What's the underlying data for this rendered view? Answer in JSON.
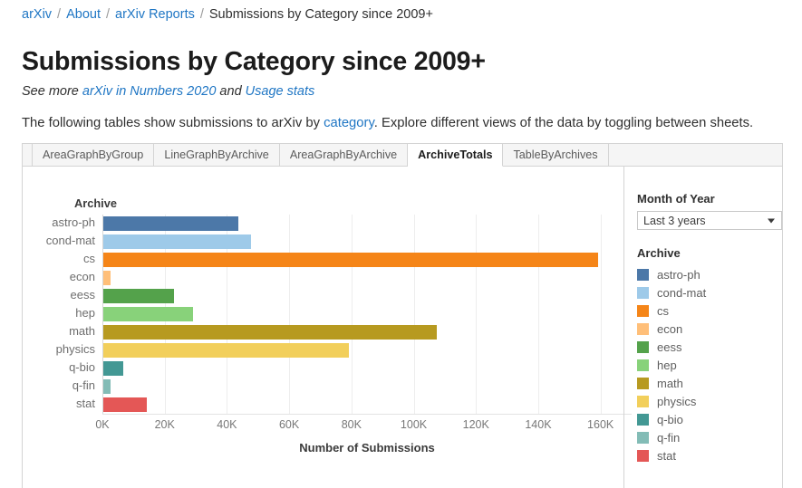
{
  "breadcrumb": {
    "items": [
      {
        "label": "arXiv",
        "link": true
      },
      {
        "label": "About",
        "link": true
      },
      {
        "label": "arXiv Reports",
        "link": true
      },
      {
        "label": "Submissions by Category since 2009+",
        "link": false
      }
    ],
    "separator": "/"
  },
  "page_title": "Submissions by Category since 2009+",
  "seemore": {
    "prefix": "See more ",
    "link1": "arXiv in Numbers 2020",
    "middle": " and ",
    "link2": "Usage stats"
  },
  "intro": {
    "part1": "The following tables show submissions to arXiv by ",
    "link": "category",
    "part2": ". Explore different views of the data by toggling between sheets."
  },
  "tabs": [
    {
      "label": "AreaGraphByGroup",
      "active": false
    },
    {
      "label": "LineGraphByArchive",
      "active": false
    },
    {
      "label": "AreaGraphByArchive",
      "active": false
    },
    {
      "label": "ArchiveTotals",
      "active": true
    },
    {
      "label": "TableByArchives",
      "active": false
    }
  ],
  "filter": {
    "label": "Month of Year",
    "value": "Last 3 years",
    "caret": "chevron-down-icon"
  },
  "legend": {
    "title": "Archive",
    "items": [
      {
        "label": "astro-ph",
        "color": "#4c78a8"
      },
      {
        "label": "cond-mat",
        "color": "#9ecae9"
      },
      {
        "label": "cs",
        "color": "#f58518"
      },
      {
        "label": "econ",
        "color": "#ffbf79"
      },
      {
        "label": "eess",
        "color": "#54a24b"
      },
      {
        "label": "hep",
        "color": "#88d27a"
      },
      {
        "label": "math",
        "color": "#b79a20"
      },
      {
        "label": "physics",
        "color": "#f2cf5b"
      },
      {
        "label": "q-bio",
        "color": "#439894"
      },
      {
        "label": "q-fin",
        "color": "#83bcb6"
      },
      {
        "label": "stat",
        "color": "#e45756"
      }
    ]
  },
  "chart_data": {
    "type": "bar",
    "orientation": "horizontal",
    "title": "",
    "xlabel": "Number of Submissions",
    "ylabel": "Archive",
    "xlim": [
      0,
      170000
    ],
    "xticks": [
      0,
      20000,
      40000,
      60000,
      80000,
      100000,
      120000,
      140000,
      160000
    ],
    "xticklabels": [
      "0K",
      "20K",
      "40K",
      "60K",
      "80K",
      "100K",
      "120K",
      "140K",
      "160K"
    ],
    "grid": true,
    "legend_position": "right",
    "categories": [
      "astro-ph",
      "cond-mat",
      "cs",
      "econ",
      "eess",
      "hep",
      "math",
      "physics",
      "q-bio",
      "q-fin",
      "stat"
    ],
    "values": [
      43500,
      47500,
      159000,
      2300,
      22800,
      28800,
      107000,
      79000,
      6500,
      2300,
      14000
    ],
    "colors": [
      "#4c78a8",
      "#9ecae9",
      "#f58518",
      "#ffbf79",
      "#54a24b",
      "#88d27a",
      "#b79a20",
      "#f2cf5b",
      "#439894",
      "#83bcb6",
      "#e45756"
    ]
  }
}
